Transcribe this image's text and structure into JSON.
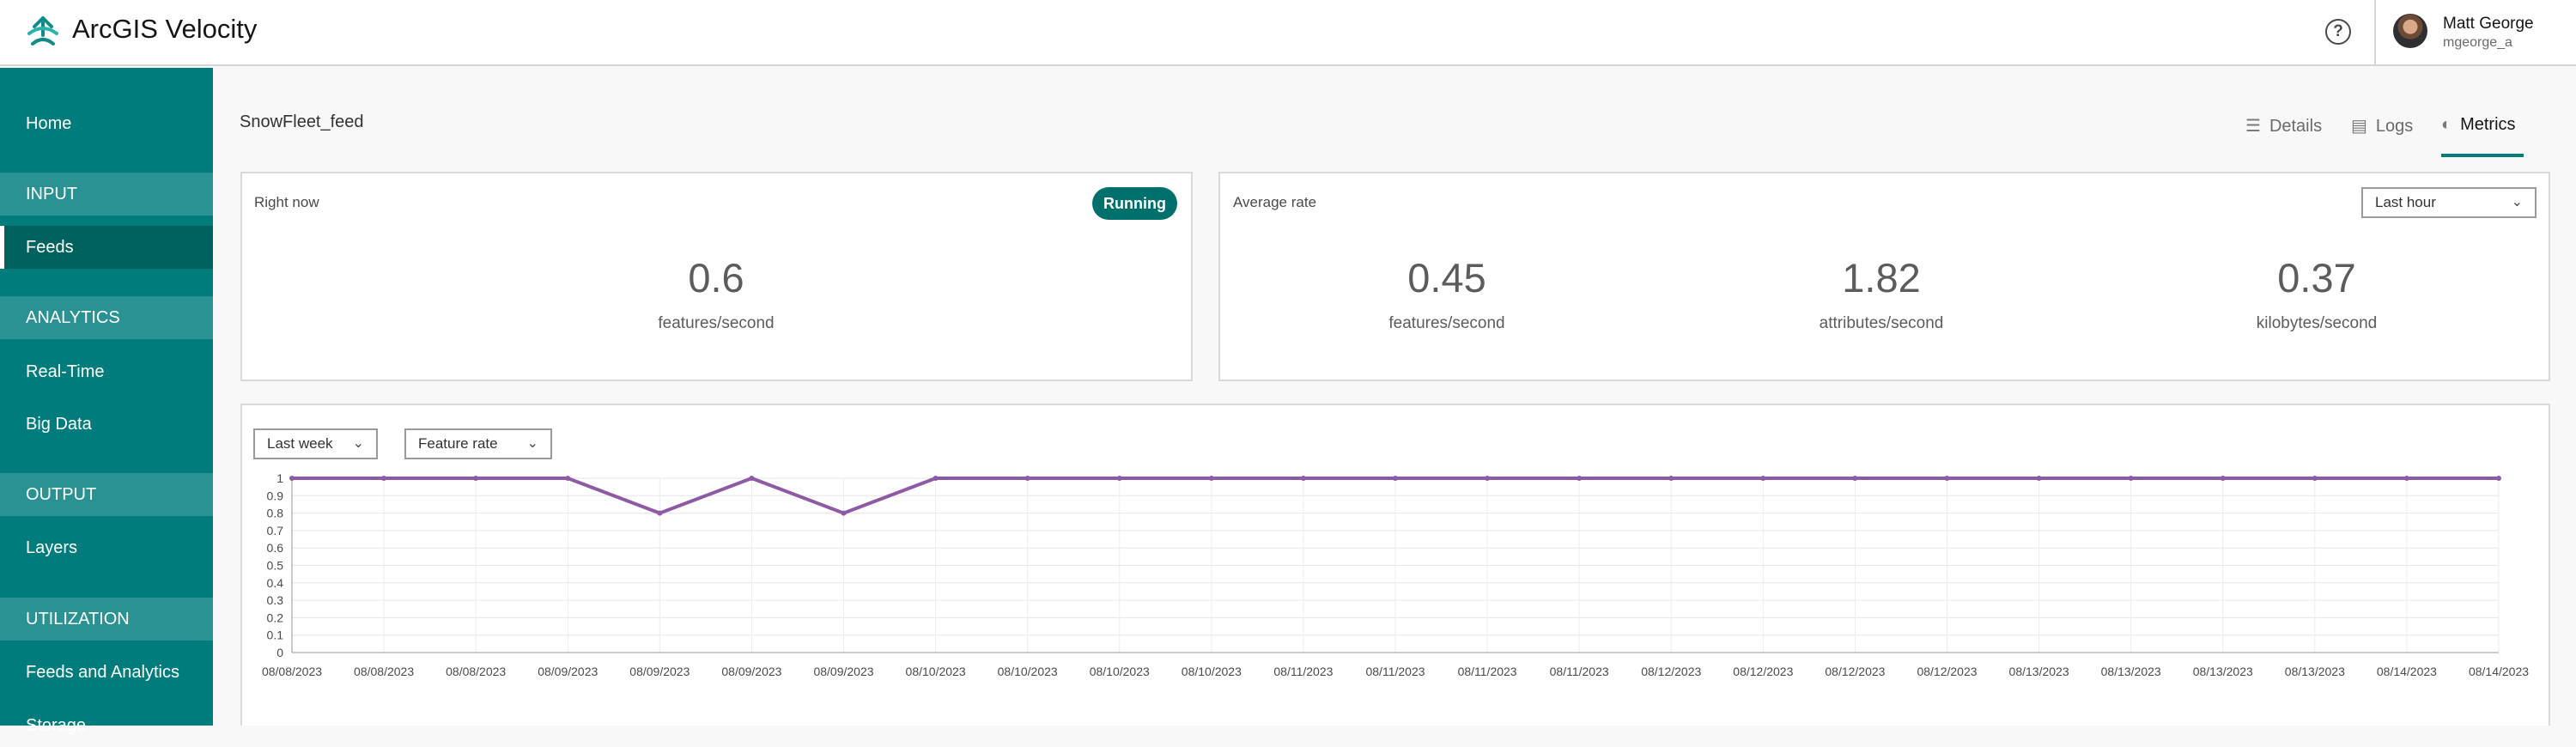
{
  "header": {
    "app_title": "ArcGIS Velocity",
    "help_icon": "?",
    "user_name": "Matt George",
    "user_handle": "mgeorge_a"
  },
  "sidebar": {
    "home": "Home",
    "input_section": "INPUT",
    "feeds": "Feeds",
    "analytics_section": "ANALYTICS",
    "real_time": "Real-Time",
    "big_data": "Big Data",
    "output_section": "OUTPUT",
    "layers": "Layers",
    "utilization_section": "UTILIZATION",
    "feeds_and_analytics": "Feeds and Analytics",
    "storage": "Storage"
  },
  "page": {
    "feed_name": "SnowFleet_feed",
    "tabs": [
      {
        "label": "Details",
        "icon": "details-icon"
      },
      {
        "label": "Logs",
        "icon": "logs-icon"
      },
      {
        "label": "Metrics",
        "icon": "gauge-icon"
      }
    ],
    "selected_tab": "Metrics"
  },
  "right_now": {
    "label": "Right now",
    "status": "Running",
    "value": "0.6",
    "unit": "features/second"
  },
  "average_rate": {
    "label": "Average rate",
    "range_select": "Last hour",
    "metrics": [
      {
        "value": "0.45",
        "unit": "features/second"
      },
      {
        "value": "1.82",
        "unit": "attributes/second"
      },
      {
        "value": "0.37",
        "unit": "kilobytes/second"
      }
    ]
  },
  "chart_controls": {
    "range_select": "Last week",
    "metric_select": "Feature rate"
  },
  "colors": {
    "brand": "#007c7c",
    "line": "#8e5aa5"
  },
  "chart_data": {
    "type": "line",
    "title": "",
    "xlabel": "",
    "ylabel": "",
    "ylim": [
      0,
      1
    ],
    "yticks": [
      "0",
      "0.1",
      "0.2",
      "0.3",
      "0.4",
      "0.5",
      "0.6",
      "0.7",
      "0.8",
      "0.9",
      "1"
    ],
    "grid": true,
    "x": [
      "08/08/2023",
      "08/08/2023",
      "08/08/2023",
      "08/09/2023",
      "08/09/2023",
      "08/09/2023",
      "08/09/2023",
      "08/10/2023",
      "08/10/2023",
      "08/10/2023",
      "08/10/2023",
      "08/11/2023",
      "08/11/2023",
      "08/11/2023",
      "08/11/2023",
      "08/12/2023",
      "08/12/2023",
      "08/12/2023",
      "08/12/2023",
      "08/13/2023",
      "08/13/2023",
      "08/13/2023",
      "08/13/2023",
      "08/14/2023",
      "08/14/2023"
    ],
    "series": [
      {
        "values": [
          1,
          1,
          1,
          1,
          0.8,
          1,
          0.8,
          1,
          1,
          1,
          1,
          1,
          1,
          1,
          1,
          1,
          1,
          1,
          1,
          1,
          1,
          1,
          1,
          1,
          1
        ]
      }
    ]
  }
}
